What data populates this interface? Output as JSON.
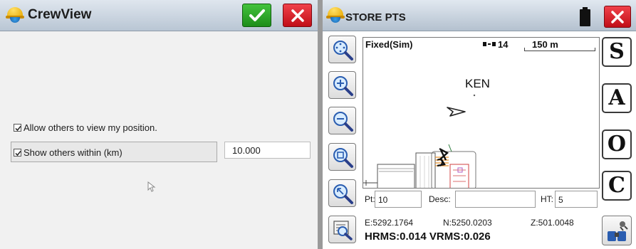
{
  "left_panel": {
    "title": "CrewView",
    "ok_button": "checkmark-icon",
    "close_button": "close-icon",
    "allow_view": {
      "label": "Allow others to view my position.",
      "checked": true
    },
    "show_others": {
      "label": "Show others within (km)",
      "checked": true,
      "value": "10.000"
    }
  },
  "right_panel": {
    "title": "STORE PTS",
    "status": {
      "fix": "Fixed(Sim)",
      "satellites": "14",
      "scale": "150 m"
    },
    "map": {
      "point_label": "KEN"
    },
    "side_buttons": [
      "S",
      "A",
      "O",
      "C"
    ],
    "entry": {
      "pt_label": "Pt:",
      "pt_value": "10",
      "desc_label": "Desc:",
      "desc_value": "",
      "ht_label": "HT:",
      "ht_value": "5"
    },
    "coords": {
      "east": "E:5292.1764",
      "north": "N:5250.0203",
      "elev": "Z:501.0048",
      "rms": "HRMS:0.014 VRMS:0.026"
    }
  },
  "colors": {
    "ok_green": "#1d8d1a",
    "close_red": "#c10e18",
    "title_bar": "#b9c6d4"
  }
}
